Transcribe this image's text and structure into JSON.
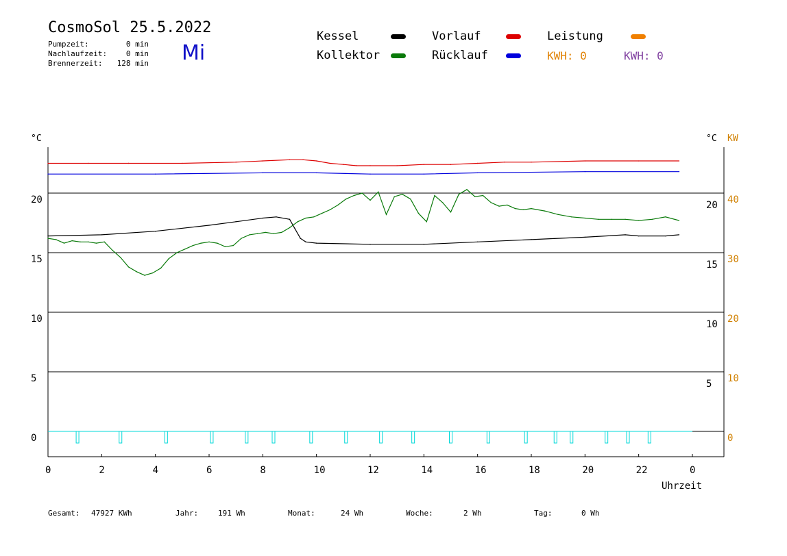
{
  "header": {
    "title": "CosmoSol 25.5.2022",
    "weekday": "Mi",
    "stats": [
      {
        "label": "Pumpzeit:",
        "value": "0 min"
      },
      {
        "label": "Nachlaufzeit:",
        "value": "0 min"
      },
      {
        "label": "Brennerzeit:",
        "value": "128 min"
      }
    ]
  },
  "legend": {
    "kessel": {
      "label": "Kessel",
      "color": "#000000"
    },
    "kollektor": {
      "label": "Kollektor",
      "color": "#0a7a0a"
    },
    "vorlauf": {
      "label": "Vorlauf",
      "color": "#dd0000"
    },
    "ruecklauf": {
      "label": "Rücklauf",
      "color": "#0000dd"
    },
    "leistung": {
      "label": "Leistung",
      "color": "#f08000"
    },
    "kwh_orange": {
      "label": "KWH: 0",
      "color": "#e08000"
    },
    "kwh_purple": {
      "label": "KWH: 0",
      "color": "#8040a0"
    }
  },
  "footer": [
    {
      "label": "Gesamt:",
      "value": "47927 KWh"
    },
    {
      "label": "Jahr:",
      "value": "191 Wh"
    },
    {
      "label": "Monat:",
      "value": "24 Wh"
    },
    {
      "label": "Woche:",
      "value": "2 Wh"
    },
    {
      "label": "Tag:",
      "value": "0 Wh"
    }
  ],
  "chart_data": {
    "type": "line",
    "xlabel": "Uhrzeit",
    "x_ticks": [
      "0",
      "2",
      "4",
      "6",
      "8",
      "10",
      "12",
      "14",
      "16",
      "18",
      "20",
      "22",
      "0"
    ],
    "xlim": [
      0,
      24
    ],
    "left_axis": {
      "unit": "°C",
      "ticks": [
        0,
        5,
        10,
        15,
        20
      ],
      "ylim": [
        0,
        24
      ]
    },
    "right_axis_temp": {
      "unit": "°C",
      "ticks": [
        5,
        10,
        15,
        20
      ]
    },
    "right_axis_power": {
      "unit": "KW",
      "ticks": [
        0,
        10,
        20,
        30,
        40
      ],
      "color": "#d08000"
    },
    "grid": true,
    "series": [
      {
        "name": "Vorlauf",
        "color": "#dd0000",
        "x": [
          0,
          1.5,
          3,
          5,
          7,
          8,
          9,
          9.5,
          10,
          10.5,
          11,
          11.5,
          12,
          13,
          14,
          15,
          16,
          17,
          18,
          20,
          22,
          23.5
        ],
        "y": [
          22.5,
          22.5,
          22.5,
          22.5,
          22.6,
          22.7,
          22.8,
          22.8,
          22.7,
          22.5,
          22.4,
          22.3,
          22.3,
          22.3,
          22.4,
          22.4,
          22.5,
          22.6,
          22.6,
          22.7,
          22.7,
          22.7
        ]
      },
      {
        "name": "Rücklauf",
        "color": "#0000dd",
        "x": [
          0,
          4,
          8,
          10,
          12,
          14,
          16,
          20,
          23.5
        ],
        "y": [
          21.6,
          21.6,
          21.7,
          21.7,
          21.6,
          21.6,
          21.7,
          21.8,
          21.8
        ]
      },
      {
        "name": "Kessel",
        "color": "#000000",
        "x": [
          0,
          2,
          4,
          6,
          7,
          8,
          8.5,
          9,
          9.2,
          9.4,
          9.6,
          10,
          12,
          14,
          16,
          18,
          20,
          21.5,
          22,
          23,
          23.5
        ],
        "y": [
          16.4,
          16.5,
          16.8,
          17.3,
          17.6,
          17.9,
          18.0,
          17.8,
          17.0,
          16.2,
          15.9,
          15.8,
          15.7,
          15.7,
          15.9,
          16.1,
          16.3,
          16.5,
          16.4,
          16.4,
          16.5
        ]
      },
      {
        "name": "Kollektor",
        "color": "#0a7a0a",
        "x": [
          0,
          0.3,
          0.6,
          0.9,
          1.2,
          1.5,
          1.8,
          2.1,
          2.4,
          2.7,
          3.0,
          3.3,
          3.6,
          3.9,
          4.2,
          4.5,
          4.8,
          5.1,
          5.4,
          5.7,
          6.0,
          6.3,
          6.6,
          6.9,
          7.2,
          7.5,
          7.8,
          8.1,
          8.4,
          8.7,
          9.0,
          9.3,
          9.6,
          9.9,
          10.2,
          10.5,
          10.8,
          11.1,
          11.4,
          11.7,
          12.0,
          12.3,
          12.6,
          12.9,
          13.2,
          13.5,
          13.8,
          14.1,
          14.4,
          14.7,
          15.0,
          15.3,
          15.6,
          15.9,
          16.2,
          16.5,
          16.8,
          17.1,
          17.4,
          17.7,
          18.0,
          18.5,
          19.0,
          19.5,
          20.0,
          20.5,
          21.0,
          21.5,
          22.0,
          22.5,
          23.0,
          23.5
        ],
        "y": [
          16.2,
          16.1,
          15.8,
          16.0,
          15.9,
          15.9,
          15.8,
          15.9,
          15.2,
          14.6,
          13.8,
          13.4,
          13.1,
          13.3,
          13.7,
          14.5,
          15.0,
          15.3,
          15.6,
          15.8,
          15.9,
          15.8,
          15.5,
          15.6,
          16.2,
          16.5,
          16.6,
          16.7,
          16.6,
          16.7,
          17.1,
          17.6,
          17.9,
          18.0,
          18.3,
          18.6,
          19.0,
          19.5,
          19.8,
          20.0,
          19.4,
          20.1,
          18.2,
          19.7,
          19.9,
          19.5,
          18.3,
          17.6,
          19.8,
          19.2,
          18.4,
          19.9,
          20.3,
          19.7,
          19.8,
          19.2,
          18.9,
          19.0,
          18.7,
          18.6,
          18.7,
          18.5,
          18.2,
          18.0,
          17.9,
          17.8,
          17.8,
          17.8,
          17.7,
          17.8,
          18.0,
          17.7
        ]
      },
      {
        "name": "Leistung",
        "color": "#00d8d8",
        "x": [
          1.1,
          2.7,
          4.4,
          6.1,
          7.4,
          8.4,
          9.8,
          11.1,
          12.4,
          13.6,
          15.0,
          16.4,
          17.8,
          18.9,
          19.5,
          20.8,
          21.6,
          22.4
        ],
        "y": [
          0,
          0,
          0,
          0,
          0,
          0,
          0,
          0,
          0,
          0,
          0,
          0,
          0,
          0,
          0,
          0,
          0,
          0
        ]
      }
    ]
  }
}
